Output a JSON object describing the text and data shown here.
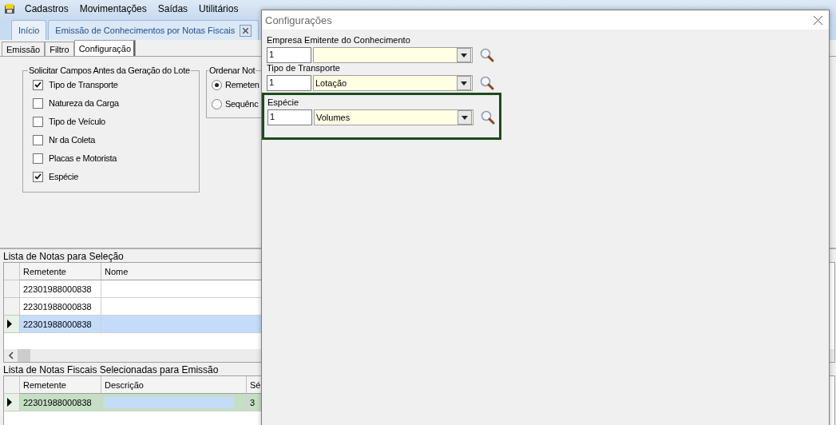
{
  "menu": [
    {
      "label": "Cadastros"
    },
    {
      "label": "Movimentações"
    },
    {
      "label": "Saídas"
    },
    {
      "label": "Utilitários"
    }
  ],
  "tabs": [
    {
      "label": "Início",
      "selected": false,
      "closable": false
    },
    {
      "label": "Emissão de Conhecimentos por Notas Fiscais",
      "selected": true,
      "closable": true
    }
  ],
  "subtabs": [
    {
      "label": "Emissão",
      "selected": false
    },
    {
      "label": "Filtro",
      "selected": false
    },
    {
      "label": "Configuração",
      "selected": true
    }
  ],
  "request_group": {
    "title": "Solicitar Campos Antes da Geração do Lote",
    "options": [
      {
        "label": "Tipo de Transporte",
        "checked": true
      },
      {
        "label": "Natureza da Carga",
        "checked": false
      },
      {
        "label": "Tipo de Veículo",
        "checked": false
      },
      {
        "label": "Nr da Coleta",
        "checked": false
      },
      {
        "label": "Placas e Motorista",
        "checked": false
      },
      {
        "label": "Espécie",
        "checked": true
      }
    ]
  },
  "order_group": {
    "title": "Ordenar Not",
    "options": [
      {
        "label": "Remeten",
        "selected": true
      },
      {
        "label": "Sequênc",
        "selected": false
      }
    ]
  },
  "selection_list": {
    "title": "Lista de Notas para Seleção",
    "columns": [
      "Remetente",
      "Nome"
    ],
    "rows": [
      {
        "remetente": "22301988000838",
        "selected": false
      },
      {
        "remetente": "22301988000838",
        "selected": false
      },
      {
        "remetente": "22301988000838",
        "selected": true
      }
    ]
  },
  "emission_list": {
    "title": "Lista de Notas Fiscais Selecionadas para Emissão",
    "columns": [
      "Remetente",
      "Descrição",
      "Sé"
    ],
    "rows": [
      {
        "remetente": "22301988000838",
        "column_3": "3",
        "selected": true
      }
    ]
  },
  "dialog": {
    "title": "Configurações",
    "fields": [
      {
        "label": "Empresa Emitente do Conhecimento",
        "code": "1",
        "highlighted": false
      },
      {
        "label": "Tipo de Transporte",
        "code": "1",
        "value": "Lotação",
        "highlighted": false
      },
      {
        "label": "Espécie",
        "code": "1",
        "value": "Volumes",
        "highlighted": true
      }
    ]
  }
}
